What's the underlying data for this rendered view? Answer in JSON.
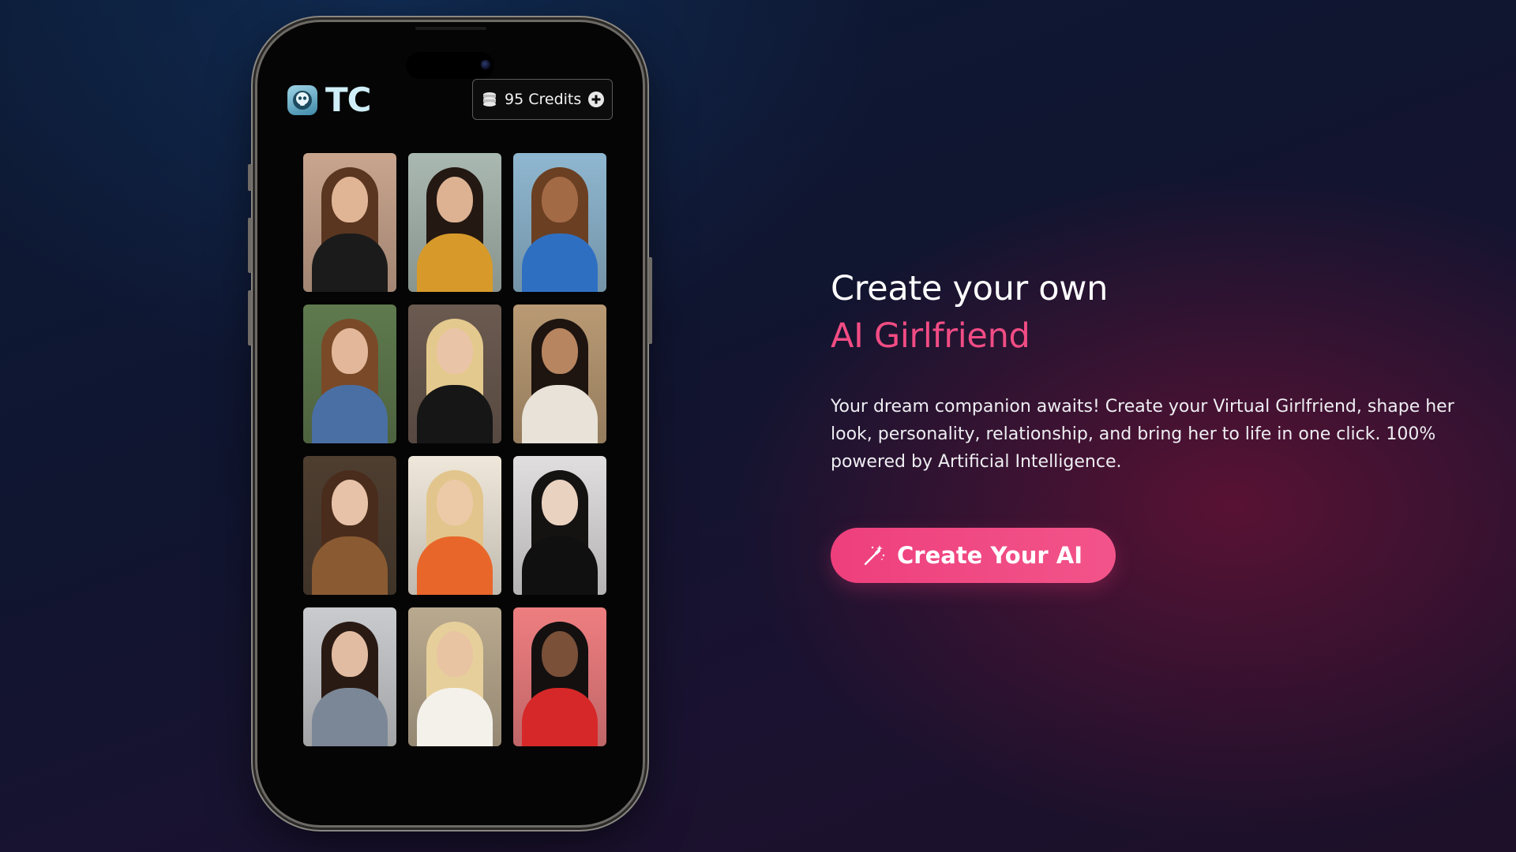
{
  "app": {
    "name": "TC",
    "logo_icon": "robot-face-icon",
    "credits_label": "95 Credits",
    "credits_icon": "coins-stack-icon",
    "add_credits_icon": "plus-circle-icon"
  },
  "gallery": {
    "items": [
      {
        "alt": "girlfriend-1",
        "bg": "#c9a58e",
        "hair": "#5a3620",
        "skin": "#e0b596",
        "outfit": "#1b1b1b"
      },
      {
        "alt": "girlfriend-2",
        "bg": "#a9b8b0",
        "hair": "#241812",
        "skin": "#dcb292",
        "outfit": "#d79a2a"
      },
      {
        "alt": "girlfriend-3",
        "bg": "#8fb7d0",
        "hair": "#6b3f22",
        "skin": "#a36a46",
        "outfit": "#2f6fc2"
      },
      {
        "alt": "girlfriend-4",
        "bg": "#5f7a4e",
        "hair": "#7a4a28",
        "skin": "#e2b79a",
        "outfit": "#4a6fa4"
      },
      {
        "alt": "girlfriend-5",
        "bg": "#6b5a50",
        "hair": "#e4c98e",
        "skin": "#eac4a6",
        "outfit": "#161616"
      },
      {
        "alt": "girlfriend-6",
        "bg": "#b99a74",
        "hair": "#1e1410",
        "skin": "#b78560",
        "outfit": "#e8e2d8"
      },
      {
        "alt": "girlfriend-7",
        "bg": "#4e3e30",
        "hair": "#4a2c1c",
        "skin": "#e8c2a8",
        "outfit": "#8a5a32"
      },
      {
        "alt": "girlfriend-8",
        "bg": "#efe7da",
        "hair": "#e2c58c",
        "skin": "#eccaa8",
        "outfit": "#e8662a"
      },
      {
        "alt": "girlfriend-9",
        "bg": "#e0dede",
        "hair": "#151212",
        "skin": "#ead2c0",
        "outfit": "#101010"
      },
      {
        "alt": "girlfriend-10",
        "bg": "#c9cbce",
        "hair": "#2a1a14",
        "skin": "#e2bca2",
        "outfit": "#7b8796"
      },
      {
        "alt": "girlfriend-11",
        "bg": "#b9a98f",
        "hair": "#e6cf9a",
        "skin": "#e8c4a2",
        "outfit": "#f4f1ea"
      },
      {
        "alt": "girlfriend-12",
        "bg": "#ee7e80",
        "hair": "#141010",
        "skin": "#7a5038",
        "outfit": "#d62828"
      }
    ]
  },
  "hero": {
    "title_line1": "Create your own",
    "title_line2": "AI Girlfriend",
    "description": "Your dream companion awaits! Create your Virtual Girlfriend, shape her look, personality, relationship, and bring her to life in one click. 100% powered by Artificial Intelligence.",
    "cta_label": "Create Your AI",
    "cta_icon": "magic-wand-icon"
  },
  "colors": {
    "accent": "#f24c84",
    "background_dark": "#101530"
  }
}
